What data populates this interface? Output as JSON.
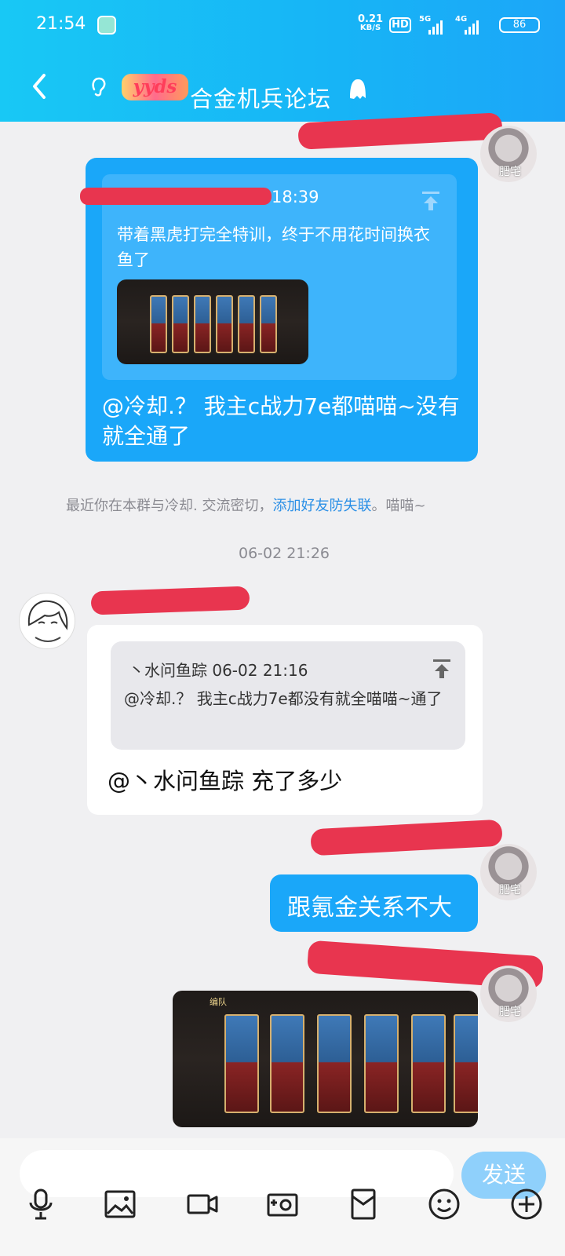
{
  "status_bar": {
    "time": "21:54",
    "net_speed_value": "0.21",
    "net_speed_unit": "KB/S",
    "hd_badge": "HD",
    "network_5g": "5G",
    "network_4g": "4G",
    "battery": "86",
    "icons": [
      "app-icon",
      "hd-icon",
      "signal-5g-icon",
      "signal-4g-icon",
      "battery-icon"
    ]
  },
  "header": {
    "back_icon": "chevron-left-icon",
    "ear_icon": "ear-icon",
    "logo_text": "yyds",
    "title": "合金机兵论坛",
    "menu_icon": "ghost-icon"
  },
  "messages": [
    {
      "type": "outgoing",
      "avatar_label": "肥宅",
      "quote": {
        "time_suffix": "18:39",
        "text": "带着黑虎打完全特训，终于不用花时间换衣鱼了",
        "icon": "pin-up-icon"
      },
      "text": "@冷却.？  我主c战力7e都喵喵~没有就全通了"
    },
    {
      "type": "system",
      "text_prefix": "最近你在本群与冷却. 交流密切，",
      "link": "添加好友防失联",
      "text_suffix": "。喵喵~"
    },
    {
      "type": "timestamp",
      "text": "06-02 21:26"
    },
    {
      "type": "incoming",
      "quote": {
        "header": "丶水问鱼踪 06-02 21:16",
        "text": "@冷却.？  我主c战力7e都没有就全喵喵~通了",
        "icon": "pin-up-icon"
      },
      "text": "@丶水问鱼踪 充了多少"
    },
    {
      "type": "outgoing",
      "avatar_label": "肥宅",
      "text": "跟氪金关系不大"
    },
    {
      "type": "outgoing_image",
      "avatar_label": "肥宅",
      "image_label": "编队"
    }
  ],
  "composer": {
    "input_placeholder": "",
    "send_label": "发送"
  },
  "toolbar": [
    {
      "name": "mic-icon"
    },
    {
      "name": "image-icon"
    },
    {
      "name": "video-icon"
    },
    {
      "name": "camera-icon"
    },
    {
      "name": "red-packet-icon"
    },
    {
      "name": "emoji-icon"
    },
    {
      "name": "plus-icon"
    }
  ],
  "colors": {
    "header_blue": "#18c8f5",
    "bubble_blue": "#1aa7f9",
    "redaction": "#e8354f",
    "link": "#2a8fe6"
  }
}
